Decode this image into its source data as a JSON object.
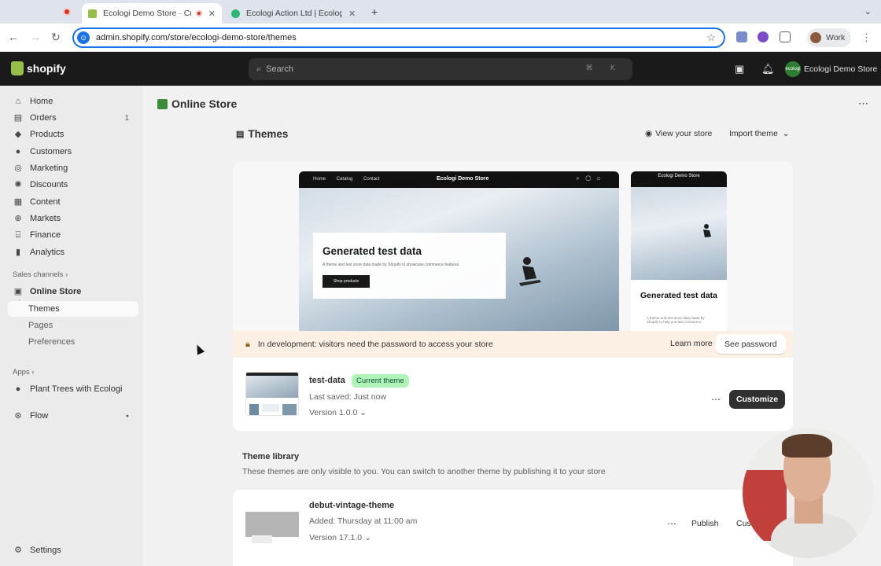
{
  "browser": {
    "tabs": [
      {
        "title": "Ecologi Demo Store · Cus"
      },
      {
        "title": "Ecologi Action Ltd | Ecologi"
      }
    ],
    "url": "admin.shopify.com/store/ecologi-demo-store/themes",
    "profile_label": "Work"
  },
  "topbar": {
    "logo_text": "shopify",
    "search_placeholder": "Search",
    "shortcut": "⌘ K",
    "store_name": "Ecologi Demo Store",
    "store_avatar_text": "ecologi"
  },
  "sidebar": {
    "items": [
      {
        "label": "Home",
        "icon": "home-icon"
      },
      {
        "label": "Orders",
        "icon": "inbox-icon",
        "badge": "1"
      },
      {
        "label": "Products",
        "icon": "tag-icon"
      },
      {
        "label": "Customers",
        "icon": "person-icon"
      },
      {
        "label": "Marketing",
        "icon": "target-icon"
      },
      {
        "label": "Discounts",
        "icon": "discount-icon"
      },
      {
        "label": "Content",
        "icon": "content-icon"
      },
      {
        "label": "Markets",
        "icon": "globe-icon"
      },
      {
        "label": "Finance",
        "icon": "bank-icon"
      },
      {
        "label": "Analytics",
        "icon": "chart-icon"
      }
    ],
    "sales_channels_label": "Sales channels",
    "online_store_label": "Online Store",
    "sub_items": [
      "Themes",
      "Pages",
      "Preferences"
    ],
    "apps_label": "Apps",
    "apps_item": "Plant Trees with Ecologi",
    "flow_label": "Flow",
    "settings_label": "Settings"
  },
  "main": {
    "page_title": "Online Store",
    "themes_title": "Themes",
    "view_store": "View your store",
    "import_theme": "Import theme",
    "preview": {
      "nav_links": "Home Catalog Contact",
      "brand": "Ecologi Demo Store",
      "mobile_brand": "Ecologi Demo Store",
      "heading": "Generated test data",
      "body": "A theme and test store data made by Shopify to showcase commerce features.",
      "button": "Shop products",
      "mobile_heading": "Generated test data",
      "mobile_body": "A theme and test store data made by Shopify to help you test commerce."
    },
    "dev_banner": {
      "text": "In development: visitors need the password to access your store",
      "learn_more": "Learn more",
      "see_password": "See password"
    },
    "current_theme": {
      "name": "test-data",
      "badge": "Current theme",
      "saved": "Last saved: Just now",
      "version": "Version 1.0.0",
      "customize": "Customize"
    },
    "library": {
      "title": "Theme library",
      "subtitle": "These themes are only visible to you. You can switch to another theme by publishing it to your store",
      "themes": [
        {
          "name": "debut-vintage-theme",
          "added": "Added: Thursday at 11:00 am",
          "version": "Version 17.1.0",
          "publish": "Publish",
          "customize": "Cus"
        }
      ]
    }
  },
  "colors": {
    "accent": "#1a73e8",
    "shopify_green": "#95bf47",
    "badge_bg": "#aff3b9",
    "banner_bg": "#fbf0e3",
    "dark_button": "#303030"
  }
}
